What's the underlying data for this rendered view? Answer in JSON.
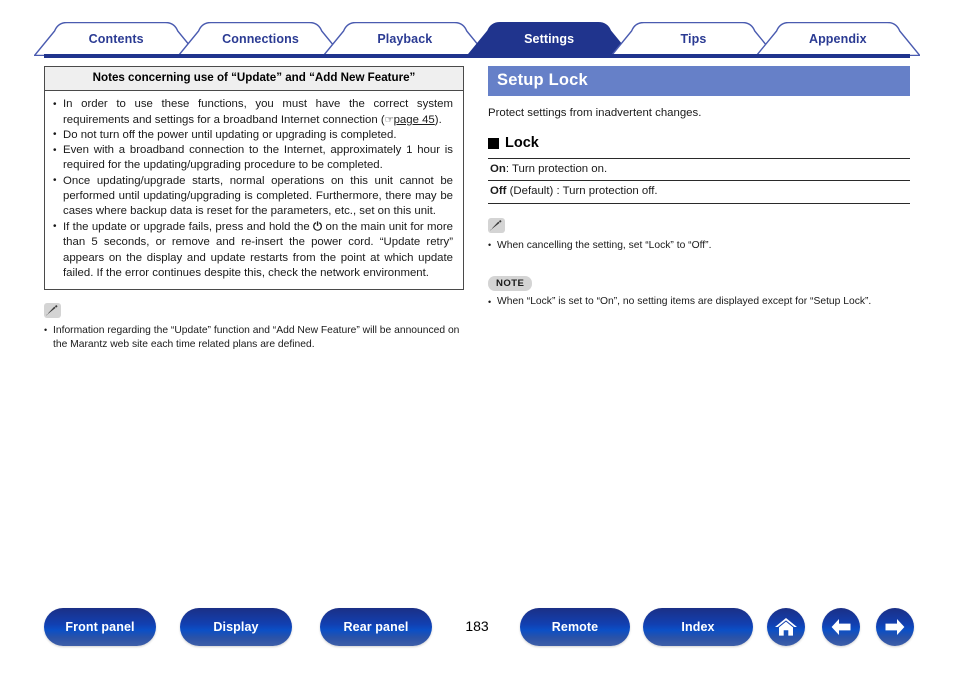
{
  "tabs": [
    {
      "label": "Contents",
      "active": false
    },
    {
      "label": "Connections",
      "active": false
    },
    {
      "label": "Playback",
      "active": false
    },
    {
      "label": "Settings",
      "active": true
    },
    {
      "label": "Tips",
      "active": false
    },
    {
      "label": "Appendix",
      "active": false
    }
  ],
  "left": {
    "box_title": "Notes concerning use of “Update” and “Add New Feature”",
    "bullets": [
      {
        "text_before": "In order to use these functions, you must have the correct system requirements and settings for a broadband Internet connection (",
        "ref_icon": "page-link-icon",
        "ref_text": "page 45",
        "text_after": ")."
      },
      {
        "text_before": "Do not turn off the power until updating or upgrading is completed."
      },
      {
        "text_before": "Even with a broadband connection to the Internet, approximately 1 hour is required for the updating/upgrading procedure to be completed."
      },
      {
        "text_before": "Once updating/upgrade starts, normal operations on this unit cannot be performed until updating/upgrading is completed. Furthermore, there may be cases where backup data is reset for the parameters, etc., set on this unit."
      },
      {
        "text_before": "If the update or upgrade fails, press and hold the ",
        "power_symbol": "⏻",
        "text_after": " on the main unit for more than 5 seconds, or remove and re-insert the power cord. “Update retry” appears on the display and update restarts from the point at which update failed. If the error continues despite this, check the network environment."
      }
    ],
    "note_icon": "pencil-icon",
    "note_text": "Information regarding the “Update” function and “Add New Feature” will be announced on the Marantz web site each time related plans are defined."
  },
  "right": {
    "section_title": "Setup Lock",
    "section_desc": "Protect settings from inadvertent changes.",
    "sub_heading": "Lock",
    "options": [
      {
        "name": "On",
        "default": "",
        "desc": ": Turn protection on."
      },
      {
        "name": "Off",
        "default": " (Default)",
        "desc": " : Turn protection off."
      }
    ],
    "note_icon": "pencil-icon",
    "note_text": "When cancelling the setting, set “Lock” to “Off”.",
    "note_badge": "NOTE",
    "note2_text": "When “Lock” is set to “On”, no setting items are displayed except for “Setup Lock”."
  },
  "footer": {
    "buttons": [
      {
        "label": "Front panel"
      },
      {
        "label": "Display"
      },
      {
        "label": "Rear panel"
      },
      {
        "label": "Remote"
      },
      {
        "label": "Index"
      }
    ],
    "icons": [
      {
        "name": "home-icon"
      },
      {
        "name": "arrow-left-icon"
      },
      {
        "name": "arrow-right-icon"
      }
    ],
    "page_number": "183"
  },
  "colors": {
    "tab_active_bg": "#20348d",
    "tab_text": "#2b3b93",
    "banner_bg": "#6680c8",
    "rule": "#20348d",
    "button_blue": "#123fb0"
  }
}
